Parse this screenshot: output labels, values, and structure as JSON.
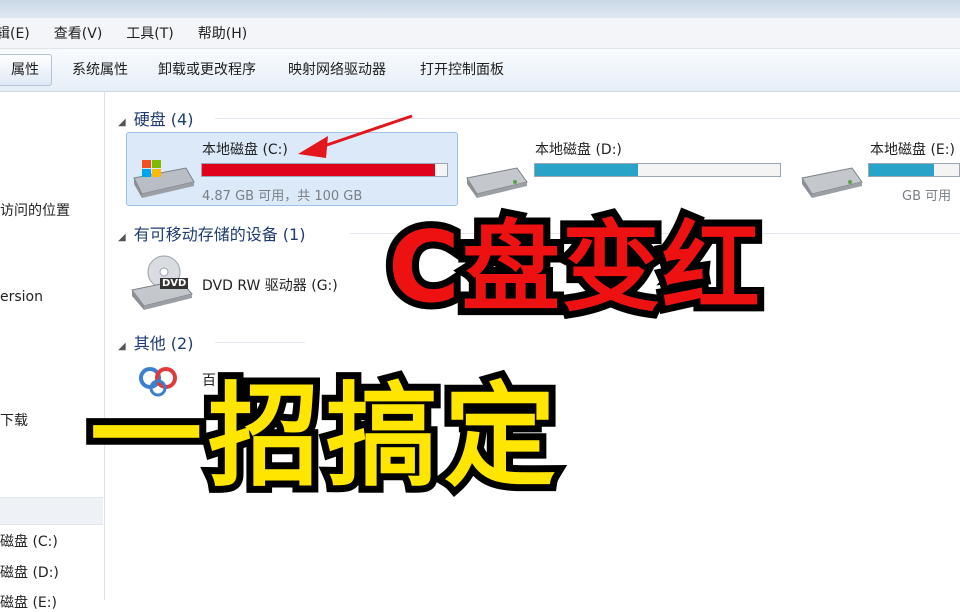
{
  "menubar": {
    "items": [
      "辑(E)",
      "查看(V)",
      "工具(T)",
      "帮助(H)"
    ]
  },
  "commandbar": {
    "items": [
      "属性",
      "系统属性",
      "卸载或更改程序",
      "映射网络驱动器",
      "打开控制面板"
    ]
  },
  "navpane": {
    "items": [
      "访问的位置",
      "ersion",
      "下载",
      "磁盘 (C:)",
      "磁盘 (D:)",
      "磁盘 (E:)"
    ]
  },
  "groups": {
    "hard_disks": "硬盘 (4)",
    "removable": "有可移动存储的设备 (1)",
    "other": "其他 (2)"
  },
  "drives": [
    {
      "name": "本地磁盘 (C:)",
      "info": "4.87 GB 可用，共 100 GB",
      "used_fraction": 0.95,
      "bar_color": "#e0001b",
      "icon": "windows-drive-icon",
      "selected": true
    },
    {
      "name": "本地磁盘 (D:)",
      "info": "",
      "used_fraction": 0.42,
      "bar_color": "#2aa3c9",
      "icon": "hard-drive-icon",
      "selected": false
    },
    {
      "name": "本地磁盘 (E:)",
      "info": "GB 可用",
      "used_fraction": 0.72,
      "bar_color": "#2aa3c9",
      "icon": "hard-drive-icon",
      "selected": false
    }
  ],
  "dvd": {
    "name": "DVD RW 驱动器 (G:)",
    "badge": "DVD",
    "icon": "dvd-drive-icon"
  },
  "other_items": [
    {
      "label": "百",
      "icon": "baidu-network-icon"
    }
  ],
  "overlay": {
    "line1": "C盘变红",
    "line2": "一招搞定",
    "line1_color": "#ee1111",
    "line2_color": "#ffe600"
  }
}
